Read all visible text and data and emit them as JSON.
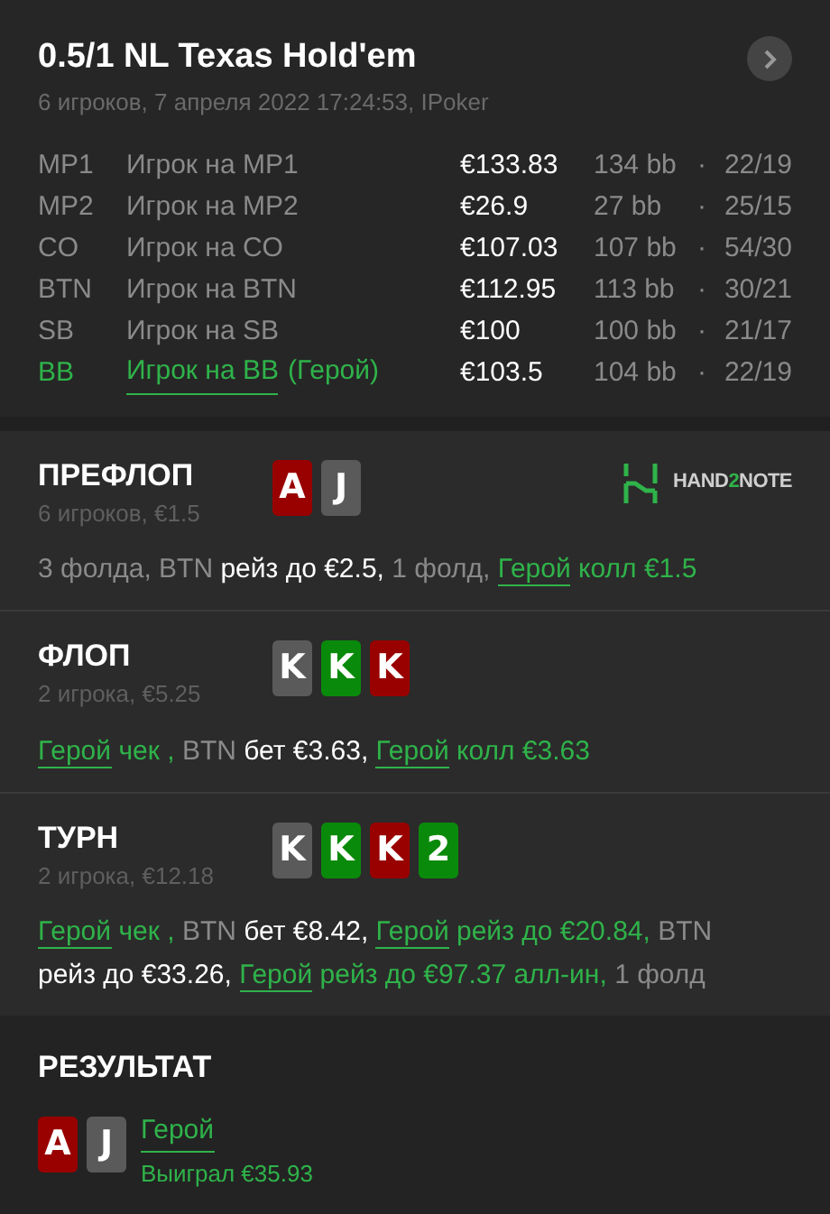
{
  "header": {
    "title": "0.5/1 NL Texas Hold'em",
    "subtitle": "6 игроков, 7 апреля 2022 17:24:53, IPoker"
  },
  "players": [
    {
      "position": "MP1",
      "name": "Игрок на MP1",
      "stack": "€133.83",
      "bb": "134 bb",
      "separator": "·",
      "stats": "22/19",
      "hero": false
    },
    {
      "position": "MP2",
      "name": "Игрок на MP2",
      "stack": "€26.9",
      "bb": "27 bb",
      "separator": "·",
      "stats": "25/15",
      "hero": false
    },
    {
      "position": "CO",
      "name": "Игрок на CO",
      "stack": "€107.03",
      "bb": "107 bb",
      "separator": "·",
      "stats": "54/30",
      "hero": false
    },
    {
      "position": "BTN",
      "name": "Игрок на BTN",
      "stack": "€112.95",
      "bb": "113 bb",
      "separator": "·",
      "stats": "30/21",
      "hero": false
    },
    {
      "position": "SB",
      "name": "Игрок на SB",
      "stack": "€100",
      "bb": "100 bb",
      "separator": "·",
      "stats": "21/17",
      "hero": false
    },
    {
      "position": "BB",
      "name": "Игрок на BB",
      "hero_tag": "(Герой)",
      "stack": "€103.5",
      "bb": "104 bb",
      "separator": "·",
      "stats": "22/19",
      "hero": true
    }
  ],
  "streets": [
    {
      "title": "ПРЕФЛОП",
      "info": "6 игроков, €1.5",
      "logo": [
        "HAND",
        "2",
        "NOTE"
      ],
      "cards": [
        {
          "rank": "A",
          "color": "#990000"
        },
        {
          "rank": "J",
          "color": "#5a5a5a"
        }
      ],
      "actions": [
        [
          {
            "kind": "muted",
            "text": "3 фолда, BTN"
          },
          {
            "kind": "plain",
            "text": "рейз до €2.5,"
          },
          {
            "kind": "muted",
            "text": "1 фолд,"
          },
          {
            "kind": "hero_link",
            "text": "Герой"
          },
          {
            "kind": "hero",
            "text": "колл €1.5"
          }
        ]
      ]
    },
    {
      "title": "ФЛОП",
      "info": "2 игрока, €5.25",
      "cards": [
        {
          "rank": "K",
          "color": "#5a5a5a"
        },
        {
          "rank": "K",
          "color": "#0a8a0a"
        },
        {
          "rank": "K",
          "color": "#990000"
        }
      ],
      "actions": [
        [
          {
            "kind": "hero_link",
            "text": "Герой"
          },
          {
            "kind": "hero",
            "text": "чек ,"
          },
          {
            "kind": "muted",
            "text": "BTN"
          },
          {
            "kind": "plain",
            "text": "бет €3.63,"
          },
          {
            "kind": "hero_link",
            "text": "Герой"
          },
          {
            "kind": "hero",
            "text": "колл €3.63"
          }
        ]
      ]
    },
    {
      "title": "ТУРН",
      "info": "2 игрока, €12.18",
      "cards": [
        {
          "rank": "K",
          "color": "#5a5a5a"
        },
        {
          "rank": "K",
          "color": "#0a8a0a"
        },
        {
          "rank": "K",
          "color": "#990000"
        },
        {
          "rank": "2",
          "color": "#0a8a0a"
        }
      ],
      "actions": [
        [
          {
            "kind": "hero_link",
            "text": "Герой"
          },
          {
            "kind": "hero",
            "text": "чек ,"
          },
          {
            "kind": "muted",
            "text": "BTN"
          },
          {
            "kind": "plain",
            "text": "бет €8.42,"
          },
          {
            "kind": "hero_link",
            "text": "Герой"
          },
          {
            "kind": "hero",
            "text": "рейз до €20.84,"
          },
          {
            "kind": "muted",
            "text": "BTN"
          }
        ],
        [
          {
            "kind": "plain",
            "text": "рейз до €33.26,"
          },
          {
            "kind": "hero_link",
            "text": "Герой"
          },
          {
            "kind": "hero",
            "text": "рейз до €97.37 алл-ин,"
          },
          {
            "kind": "muted",
            "text": "1 фолд"
          }
        ]
      ]
    }
  ],
  "result": {
    "title": "РЕЗУЛЬТАТ",
    "cards": [
      {
        "rank": "A",
        "color": "#990000"
      },
      {
        "rank": "J",
        "color": "#5a5a5a"
      }
    ],
    "winner": "Герой",
    "amount": "Выиграл €35.93"
  }
}
